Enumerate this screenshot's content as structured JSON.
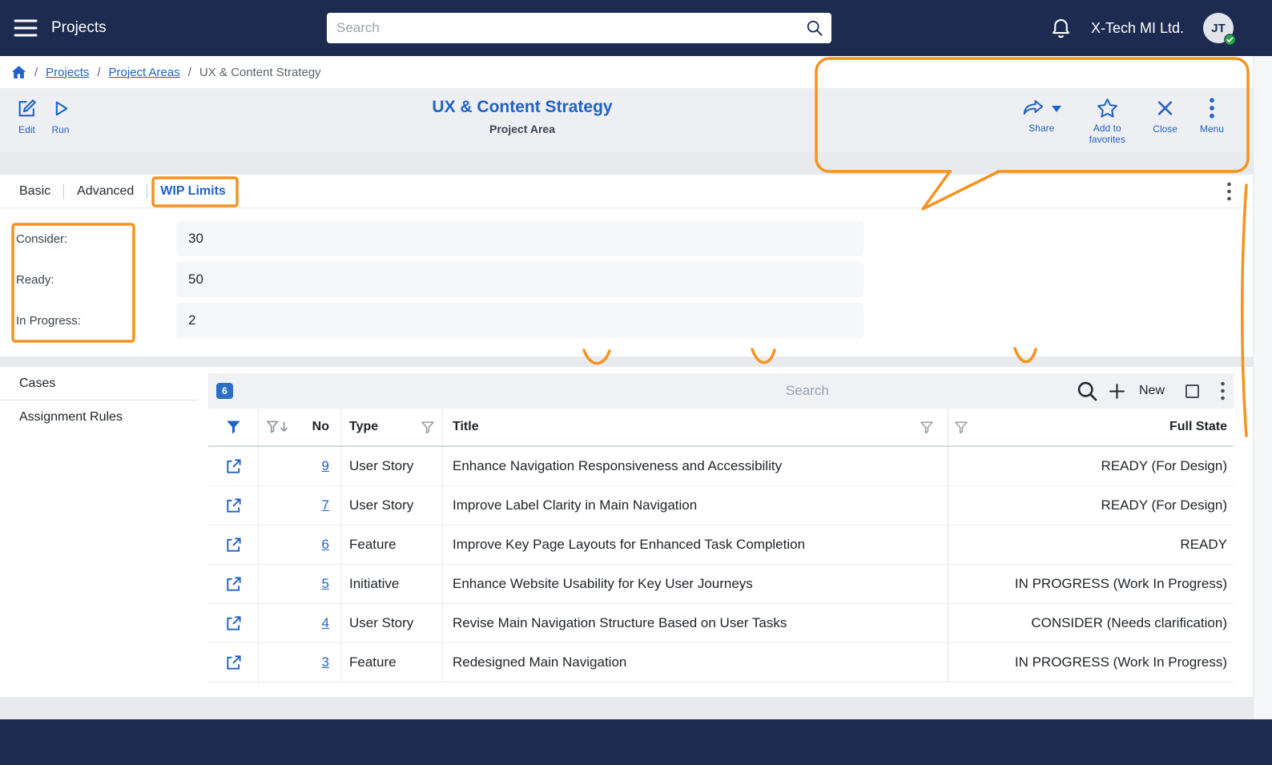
{
  "colors": {
    "navbar_bg": "#1d2b50",
    "accent_blue": "#2062c5",
    "annotation_orange": "#f6921e",
    "badge_bg": "#2a6fc2",
    "online_green": "#27a844"
  },
  "icons": {
    "hamburger": "☰",
    "search": "🔍",
    "bell": "🔔",
    "online-check": "✓",
    "home": "⌂",
    "edit": "✎",
    "run": "▷",
    "share": "↪",
    "caret-down": "▾",
    "star": "☆",
    "close": "✕",
    "kebab-menu": "⋮",
    "filter-funnel": "▼",
    "sort-down": "↓",
    "external-link": "↗",
    "plus": "+",
    "select-square": "□"
  },
  "navbar": {
    "app_title": "Projects",
    "search_placeholder": "Search",
    "company_name": "X-Tech MI Ltd.",
    "avatar_initials": "JT"
  },
  "breadcrumb": {
    "separator": "/",
    "items": [
      "Projects",
      "Project Areas",
      "UX & Content Strategy"
    ]
  },
  "header": {
    "title": "UX & Content Strategy",
    "subtitle": "Project Area",
    "edit_label": "Edit",
    "run_label": "Run",
    "share_label": "Share",
    "favorites_label": "Add to favorites",
    "close_label": "Close",
    "menu_label": "Menu"
  },
  "tabs": {
    "items": [
      {
        "label": "Basic"
      },
      {
        "label": "Advanced"
      },
      {
        "label": "WIP Limits"
      }
    ]
  },
  "wip_form": {
    "fields": [
      {
        "label": "Consider:",
        "value": "30"
      },
      {
        "label": "Ready:",
        "value": "50"
      },
      {
        "label": "In Progress:",
        "value": "2"
      }
    ]
  },
  "cases_panel": {
    "side_tabs": [
      {
        "label": "Cases"
      },
      {
        "label": "Assignment Rules"
      }
    ],
    "count_badge": "6",
    "search_placeholder": "Search",
    "new_label": "New"
  },
  "table": {
    "headers": {
      "no": "No",
      "type": "Type",
      "title": "Title",
      "full_state": "Full State"
    },
    "rows": [
      {
        "no": "9",
        "type": "User Story",
        "title": "Enhance Navigation Responsiveness and Accessibility",
        "full_state": "READY (For Design)"
      },
      {
        "no": "7",
        "type": "User Story",
        "title": "Improve Label Clarity in Main Navigation",
        "full_state": "READY (For Design)"
      },
      {
        "no": "6",
        "type": "Feature",
        "title": "Improve Key Page Layouts for Enhanced Task Completion",
        "full_state": "READY"
      },
      {
        "no": "5",
        "type": "Initiative",
        "title": "Enhance Website Usability for Key User Journeys",
        "full_state": "IN PROGRESS (Work In Progress)"
      },
      {
        "no": "4",
        "type": "User Story",
        "title": "Revise Main Navigation Structure Based on User Tasks",
        "full_state": "CONSIDER (Needs clarification)"
      },
      {
        "no": "3",
        "type": "Feature",
        "title": "Redesigned Main Navigation",
        "full_state": "IN PROGRESS (Work In Progress)"
      }
    ]
  }
}
